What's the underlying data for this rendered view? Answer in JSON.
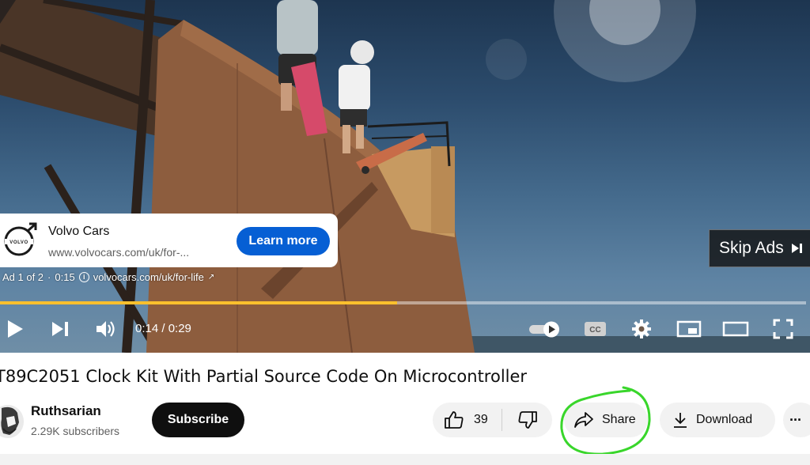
{
  "ad": {
    "advertiser": "Volvo Cars",
    "url_display": "www.volvocars.com/uk/for-...",
    "cta_label": "Learn more",
    "meta_position": "Ad 1 of 2",
    "meta_separator": "·",
    "meta_duration": "0:15",
    "meta_link": "volvocars.com/uk/for-life",
    "logo_text": "VOLVO",
    "skip_label": "Skip Ads",
    "brand_color": "#065fd4"
  },
  "player": {
    "progress": 0.493,
    "progress_color": "#fbc02d",
    "time_display": "0:14 / 0:29",
    "icons": [
      "play-icon",
      "next-icon",
      "volume-icon",
      "autoplay-toggle-icon",
      "captions-icon",
      "settings-icon",
      "miniplayer-icon",
      "theater-mode-icon",
      "fullscreen-icon"
    ],
    "cc_label": "CC"
  },
  "video": {
    "title": "T89C2051 Clock Kit With Partial Source Code On Microcontroller"
  },
  "channel": {
    "name": "Ruthsarian",
    "subscribers": "2.29K subscribers",
    "subscribe_label": "Subscribe"
  },
  "actions": {
    "likes": "39",
    "share_label": "Share",
    "download_label": "Download",
    "more_label": "···"
  },
  "annotation_color": "#39d62b"
}
